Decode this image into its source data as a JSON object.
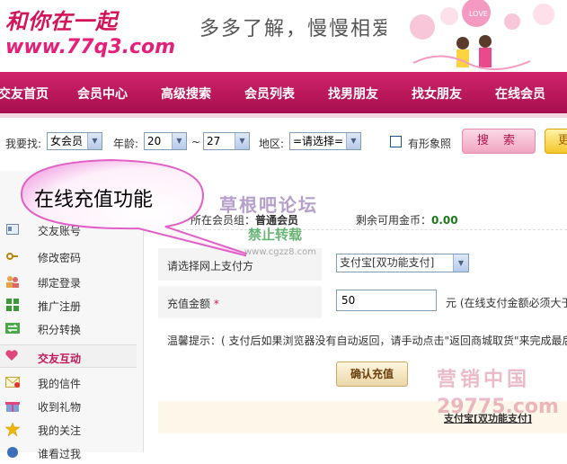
{
  "header": {
    "logo_text": "和你在一起",
    "logo_url": "www.77q3.com",
    "slogan": "多多了解，慢慢相爱"
  },
  "nav": {
    "items": [
      "交友首页",
      "会员中心",
      "高级搜索",
      "会员列表",
      "找男朋友",
      "找女朋友",
      "在线会员"
    ]
  },
  "search": {
    "find_label": "我要找:",
    "find_value": "女会员",
    "age_label": "年龄:",
    "age_from": "20",
    "age_sep": "~",
    "age_to": "27",
    "region_label": "地区:",
    "region_value": "=请选择=",
    "photo_label": "有形象照",
    "search_button": "搜 索",
    "more_button": "更"
  },
  "sidebar": {
    "items": [
      {
        "label": "交友账号",
        "icon": "card-icon"
      },
      {
        "label": "修改密码",
        "icon": "key-icon"
      },
      {
        "label": "绑定登录",
        "icon": "users-icon"
      },
      {
        "label": "推广注册",
        "icon": "grid-icon"
      },
      {
        "label": "积分转换",
        "icon": "exchange-icon"
      }
    ],
    "section": {
      "label": "交友互动",
      "icon": "heart-icon"
    },
    "items2": [
      {
        "label": "我的信件",
        "icon": "mail-icon"
      },
      {
        "label": "收到礼物",
        "icon": "gift-icon"
      },
      {
        "label": "我的关注",
        "icon": "star-icon"
      },
      {
        "label": "谁看过我",
        "icon": "eye-icon"
      }
    ]
  },
  "main": {
    "group_label": "所在会员组：",
    "group_value": "普通会员",
    "coin_label": "剩余可用金币：",
    "coin_value": "0.00",
    "pay_label": "请选择网上支付方",
    "pay_value": "支付宝[双功能支付]",
    "amount_label": "充值金额",
    "amount_required": "*",
    "amount_value": "50",
    "amount_note": "元 (在线支付金额必须大于",
    "tip": "温馨提示：( 支付后如果浏览器没有自动返回，请手动点击\"返回商城取货\"来完成最后",
    "confirm_button": "确认充值",
    "bottom_label": "支付宝[双功能支付]"
  },
  "callout": {
    "text": "在线充值功能"
  },
  "watermarks": {
    "line1": "草根吧论坛",
    "line2": "禁止转载",
    "line3": "www.cgzz8.com",
    "line4": "营销中国",
    "line5": "29775.com"
  },
  "colors": {
    "nav_bg": "#b8155a",
    "accent": "#d4145a",
    "coin_value": "#1a7a1a"
  }
}
